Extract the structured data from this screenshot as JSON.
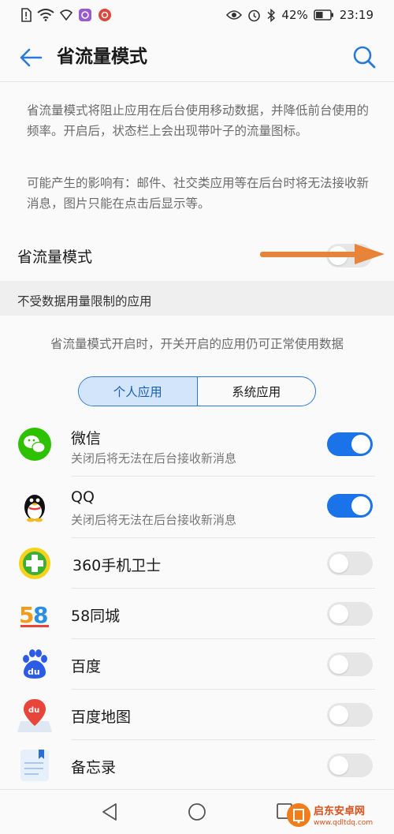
{
  "status_bar": {
    "battery": "42%",
    "time": "23:19"
  },
  "header": {
    "title": "省流量模式"
  },
  "description": {
    "para1": "省流量模式将阻止应用在后台使用移动数据，并降低前台使用的频率。开启后，状态栏上会出现带叶子的流量图标。",
    "para2": "可能产生的影响有：邮件、社交类应用等在后台时将无法接收新消息，图片只能在点击后显示等。"
  },
  "mode_toggle": {
    "label": "省流量模式",
    "on": false
  },
  "section": {
    "title": "不受数据用量限制的应用",
    "note": "省流量模式开启时，开关开启的应用仍可正常使用数据"
  },
  "tabs": [
    {
      "label": "个人应用",
      "active": true
    },
    {
      "label": "系统应用",
      "active": false
    }
  ],
  "apps": [
    {
      "name": "微信",
      "subtitle": "关闭后将无法在后台接收新消息",
      "on": true,
      "icon": "wechat-icon"
    },
    {
      "name": "QQ",
      "subtitle": "关闭后将无法在后台接收新消息",
      "on": true,
      "icon": "qq-icon"
    },
    {
      "name": "360手机卫士",
      "subtitle": "",
      "on": false,
      "icon": "360-security-icon"
    },
    {
      "name": "58同城",
      "subtitle": "",
      "on": false,
      "icon": "58-icon"
    },
    {
      "name": "百度",
      "subtitle": "",
      "on": false,
      "icon": "baidu-icon"
    },
    {
      "name": "百度地图",
      "subtitle": "",
      "on": false,
      "icon": "baidu-map-icon"
    },
    {
      "name": "备忘录",
      "subtitle": "",
      "on": false,
      "icon": "notepad-icon"
    }
  ],
  "colors": {
    "accent": "#1a73e8",
    "arrow": "#e8843a"
  },
  "watermark": {
    "brand": "启东安卓网",
    "url": "www.qdltdq.com"
  }
}
